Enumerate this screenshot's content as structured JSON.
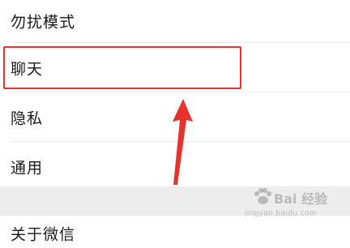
{
  "settings": {
    "items": [
      {
        "label": "勿扰模式"
      },
      {
        "label": "聊天"
      },
      {
        "label": "隐私"
      },
      {
        "label": "通用"
      },
      {
        "label": "关于微信"
      }
    ]
  },
  "watermark": {
    "brand": "Bai 经验",
    "url": "jingyan.baidu.com"
  },
  "colors": {
    "highlight": "#e8332d",
    "section_gap": "#ededed"
  },
  "icons": {
    "annotation": "arrow-up-icon",
    "watermark": "paw-icon"
  }
}
